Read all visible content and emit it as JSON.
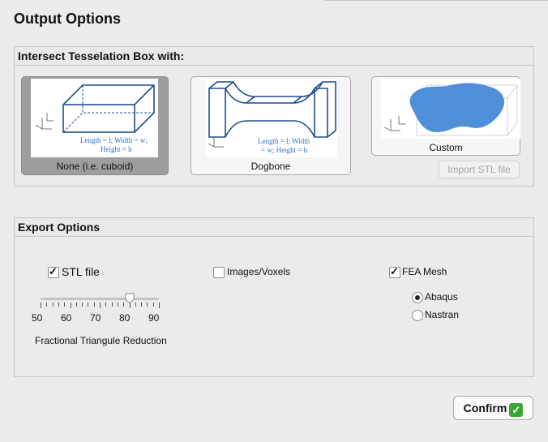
{
  "window": {
    "title": "Output Options"
  },
  "intersect": {
    "heading": "Intersect Tesselation Box with:",
    "options": [
      {
        "label": "None (i.e. cuboid)",
        "caption1": "Length = l;   Width = w;",
        "caption2": "Height = h",
        "selected": true
      },
      {
        "label": "Dogbone",
        "caption1": "Length = l;   Width",
        "caption2": "= w;   Height = h",
        "selected": false
      },
      {
        "label": "Custom",
        "selected": false
      }
    ],
    "import_button": "Import STL file"
  },
  "export": {
    "heading": "Export Options",
    "stl": {
      "label": "STL file",
      "checked": true
    },
    "images": {
      "label": "Images/Voxels",
      "checked": false
    },
    "fea": {
      "label": "FEA Mesh",
      "checked": true
    },
    "solvers": [
      {
        "label": "Abaqus",
        "selected": true
      },
      {
        "label": "Nastran",
        "selected": false
      }
    ],
    "slider": {
      "ticks": [
        "50",
        "60",
        "70",
        "80",
        "90"
      ],
      "min": 50,
      "max": 90,
      "value": 80,
      "caption": "Fractional Triangule Reduction"
    }
  },
  "confirm_label": "Confirm",
  "colors": {
    "accent": "#3aa635",
    "blue_shape": "#4e8fd8",
    "diagram_line": "#1f4e8c"
  }
}
